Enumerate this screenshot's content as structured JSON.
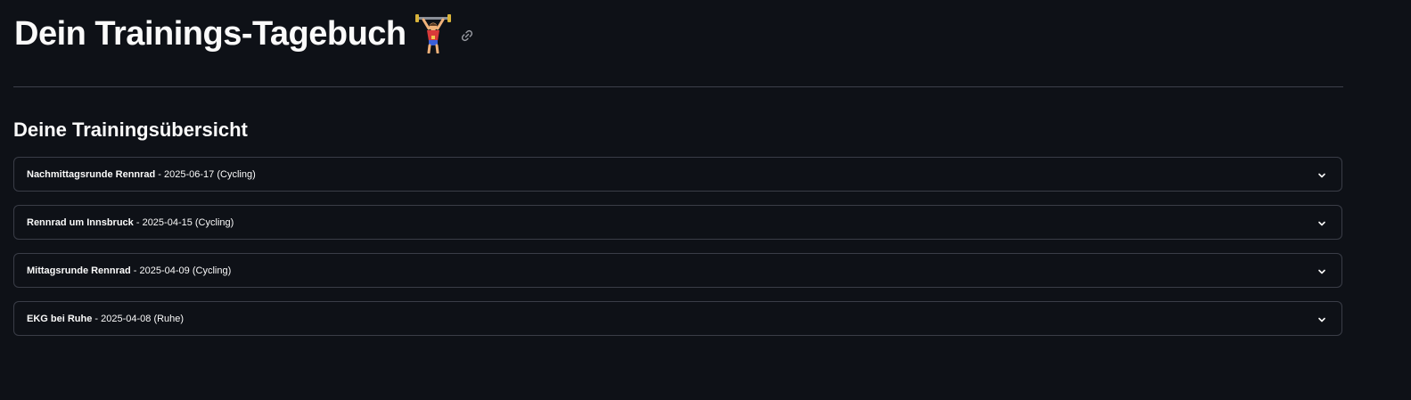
{
  "header": {
    "title": "Dein Trainings-Tagebuch",
    "emoji_icon": "weightlifter-icon",
    "link_icon": "link-icon"
  },
  "overview": {
    "heading": "Deine Trainingsübersicht",
    "items": [
      {
        "name": "Nachmittagsrunde Rennrad",
        "detail": " - 2025-06-17 (Cycling)"
      },
      {
        "name": "Rennrad um Innsbruck",
        "detail": " - 2025-04-15 (Cycling)"
      },
      {
        "name": "Mittagsrunde Rennrad",
        "detail": " - 2025-04-09 (Cycling)"
      },
      {
        "name": "EKG bei Ruhe",
        "detail": " - 2025-04-08 (Ruhe)"
      }
    ]
  },
  "colors": {
    "background": "#0e1117",
    "text": "#fafafa",
    "border": "#3a3d47"
  }
}
